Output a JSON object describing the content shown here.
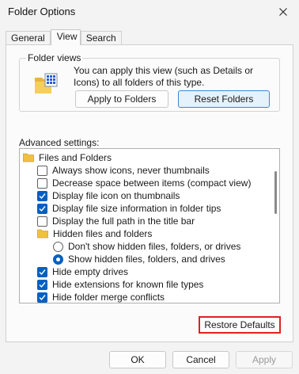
{
  "window": {
    "title": "Folder Options"
  },
  "tabs": [
    {
      "label": "General"
    },
    {
      "label": "View"
    },
    {
      "label": "Search"
    }
  ],
  "active_tab": "View",
  "folder_views": {
    "legend": "Folder views",
    "icon": "folder-grid-icon",
    "description": "You can apply this view (such as Details or Icons) to all folders of this type.",
    "apply_button": "Apply to Folders",
    "reset_button": "Reset Folders"
  },
  "advanced": {
    "label": "Advanced settings:",
    "items": [
      {
        "kind": "folder",
        "label": "Files and Folders"
      },
      {
        "kind": "checkbox",
        "checked": false,
        "label": "Always show icons, never thumbnails"
      },
      {
        "kind": "checkbox",
        "checked": false,
        "label": "Decrease space between items (compact view)"
      },
      {
        "kind": "checkbox",
        "checked": true,
        "label": "Display file icon on thumbnails"
      },
      {
        "kind": "checkbox",
        "checked": true,
        "label": "Display file size information in folder tips"
      },
      {
        "kind": "checkbox",
        "checked": false,
        "label": "Display the full path in the title bar"
      },
      {
        "kind": "folder",
        "label": "Hidden files and folders"
      },
      {
        "kind": "radio",
        "checked": false,
        "label": "Don't show hidden files, folders, or drives"
      },
      {
        "kind": "radio",
        "checked": true,
        "label": "Show hidden files, folders, and drives"
      },
      {
        "kind": "checkbox",
        "checked": true,
        "label": "Hide empty drives"
      },
      {
        "kind": "checkbox",
        "checked": true,
        "label": "Hide extensions for known file types"
      },
      {
        "kind": "checkbox",
        "checked": true,
        "label": "Hide folder merge conflicts"
      }
    ]
  },
  "restore_defaults_button": "Restore Defaults",
  "footer": {
    "ok": "OK",
    "cancel": "Cancel",
    "apply": "Apply"
  },
  "colors": {
    "accent": "#0060c0",
    "highlight": "#e02020",
    "folder": "#f0c040"
  }
}
